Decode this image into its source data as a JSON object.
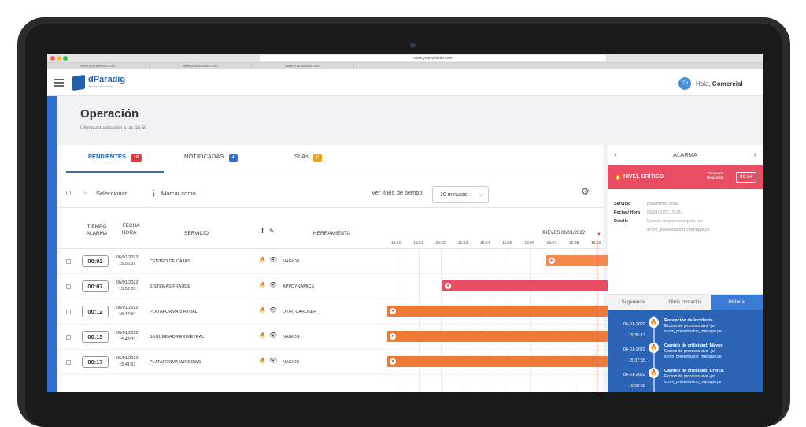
{
  "browser": {
    "url": "www.yourwebsite.com",
    "tabs": [
      "www.yourwebsite.com",
      "www.yourwebsite.com",
      "www.yourwebsite.com"
    ]
  },
  "app": {
    "logo_text": "dParadig",
    "logo_sub": "We keep IT running",
    "avatar_initials": "Co",
    "greeting": "Hola,",
    "user": "Comercial"
  },
  "page": {
    "title": "Operación",
    "subtitle": "Última actualización a las 15:59"
  },
  "tabs": [
    {
      "label": "PENDIENTES",
      "count": "10",
      "color": "#e23b3b"
    },
    {
      "label": "NOTIFICADAS",
      "count": "4",
      "color": "#2f6fcf"
    },
    {
      "label": "SLAs",
      "count": "0",
      "color": "#f0a020"
    }
  ],
  "toolbar": {
    "select_label": "Seleccionar",
    "mark_label": "Marcar como",
    "timeline_label": "Ver línea de tiempo",
    "timeline_value": "10 minutos"
  },
  "table": {
    "headers": {
      "tiempo": "TIEMPO",
      "alarma": "ALARMA",
      "fecha": "↑ FECHA",
      "hora": "HORA",
      "servicio": "SERVICIO",
      "herramienta": "HERRAMIENTA",
      "date": "JUEVES 06/01/2022"
    },
    "ticks": [
      "15:50",
      "15:51",
      "15:52",
      "15:53",
      "15:54",
      "15:55",
      "15:56",
      "15:57",
      "15:58",
      "15:59"
    ],
    "rows": [
      {
        "timer": "00:02",
        "date": "06/01/2022",
        "time": "15:56:37",
        "service": "CENTRO DE CAJAS",
        "tool": "NAGIOS",
        "bar_start": 0.72,
        "bar_color": "#f58a4b"
      },
      {
        "timer": "00:07",
        "date": "06/01/2022",
        "time": "15:52:03",
        "service": "SISTEMAS FRAUDE",
        "tool": "APPDYNAMICS",
        "bar_start": 0.25,
        "bar_color": "#e94d63"
      },
      {
        "timer": "00:12",
        "date": "06/01/2022",
        "time": "15:47:04",
        "service": "PLATAFORMA VIRTUAL",
        "tool": "DVIRTUARUSER",
        "bar_start": 0.0,
        "bar_color": "#f07a35"
      },
      {
        "timer": "00:15",
        "date": "06/01/2022",
        "time": "15:43:33",
        "service": "SEGURIDAD PERIMETRAL",
        "tool": "NAGIOS",
        "bar_start": 0.0,
        "bar_color": "#f07a35"
      },
      {
        "timer": "00:17",
        "date": "06/01/2022",
        "time": "15:41:51",
        "service": "PLATAFORMA WINDOWS",
        "tool": "NAGIOS",
        "bar_start": 0.0,
        "bar_color": "#f07a35"
      }
    ]
  },
  "alarm": {
    "title": "ALARMA",
    "level": "NIVEL CRÍTICO",
    "response_label_1": "Tiempo de",
    "response_label_2": "Respuesta",
    "response_time": "00:24",
    "servicio_k": "Servicio",
    "servicio_v": "plataforma retail",
    "fecha_k": "Fecha / Hora",
    "fecha_v": "06/01/2022 15:35",
    "detalle_k": "Detalle",
    "detalle_v1": "Exceso de procesos java -jar",
    "detalle_v2": "ecom_presentacion_manager.jar",
    "subtabs": [
      "Sugerencia",
      "Otros contactos",
      "Historial"
    ],
    "history": [
      {
        "date": "06-01-2022",
        "time": "15:35:13",
        "title": "Recepción de incidente.",
        "text": "Exceso de procesos java -jar ecom_presentacion_manager.jar"
      },
      {
        "date": "06-01-2022",
        "time": "15:37:55",
        "title": "Cambio de criticidad: Mayor.",
        "text": "Exceso de procesos java -jar ecom_presentacion_manager.jar"
      },
      {
        "date": "06-01-2022",
        "time": "15:50:28",
        "title": "Cambio de criticidad: Crítica.",
        "text": "Exceso de procesos java -jar ecom_presentacion_manager.jar"
      }
    ]
  }
}
